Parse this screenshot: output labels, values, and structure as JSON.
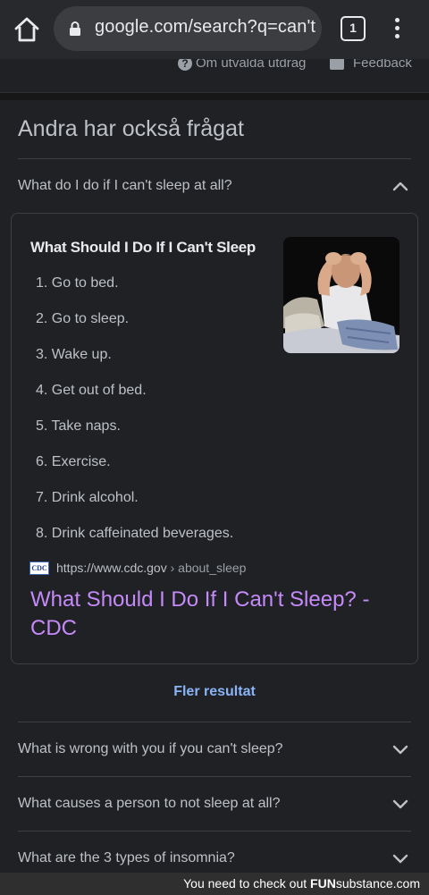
{
  "browser": {
    "url": "google.com/search?q=can't",
    "tab_count": "1"
  },
  "prev_panel": {
    "about_label": "Om utvalda utdrag",
    "feedback_label": "Feedback"
  },
  "paa": {
    "title": "Andra har också frågat",
    "expanded_question": "What do I do if I can't sleep at all?",
    "answer": {
      "heading": "What Should I Do If I Can't Sleep",
      "steps": [
        "1. Go to bed.",
        "2. Go to sleep.",
        "3. Wake up.",
        "4. Get out of bed.",
        "5. Take naps.",
        "6. Exercise.",
        "7. Drink alcohol.",
        "8. Drink caffeinated beverages."
      ],
      "favicon_text": "CDC",
      "source_url": "https://www.cdc.gov",
      "source_path": " › about_sleep",
      "result_title": "What Should I Do If I Can't Sleep? - CDC"
    },
    "more_results_label": "Fler resultat",
    "collapsed_questions": [
      "What is wrong with you if you can't sleep?",
      "What causes a person to not sleep at all?",
      "What are the 3 types of insomnia?"
    ]
  },
  "footer": {
    "text": "You need to check out ",
    "brand": "FUN",
    "brand_rest": "substance.com"
  },
  "colors": {
    "background": "#202124",
    "link_visited": "#c58af9",
    "accent_blue": "#8ab4f8"
  }
}
